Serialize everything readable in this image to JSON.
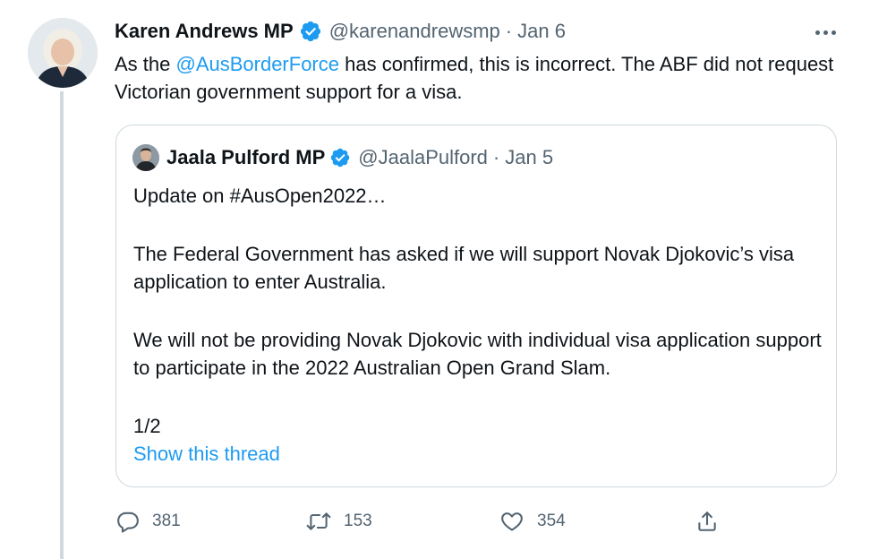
{
  "author": {
    "name": "Karen Andrews MP",
    "handle": "@karenandrewsmp",
    "separator": "·",
    "date": "Jan 6"
  },
  "tweet": {
    "text_before": "As the ",
    "mention": "@AusBorderForce",
    "text_after": " has confirmed, this is incorrect. The ABF did not request Victorian government support for a visa."
  },
  "quoted": {
    "name": "Jaala Pulford MP",
    "handle": "@JaalaPulford",
    "separator": "·",
    "date": "Jan 5",
    "paragraphs": [
      "Update on #AusOpen2022…",
      "The Federal Government has asked if we will support Novak Djokovic’s visa application to enter Australia.",
      "We will not be providing Novak Djokovic with individual visa application support to participate in the 2022 Australian Open Grand Slam.",
      "1/2"
    ],
    "show_thread": "Show this thread"
  },
  "actions": {
    "reply_count": "381",
    "retweet_count": "153",
    "like_count": "354"
  },
  "icons": {
    "verified": "verified-badge-icon",
    "more": "more-icon",
    "reply": "reply-icon",
    "retweet": "retweet-icon",
    "like": "heart-icon",
    "share": "share-icon"
  },
  "colors": {
    "link": "#1d9bf0",
    "secondary_text": "#536471",
    "border": "#cfd9de",
    "verified": "#1d9bf0"
  }
}
